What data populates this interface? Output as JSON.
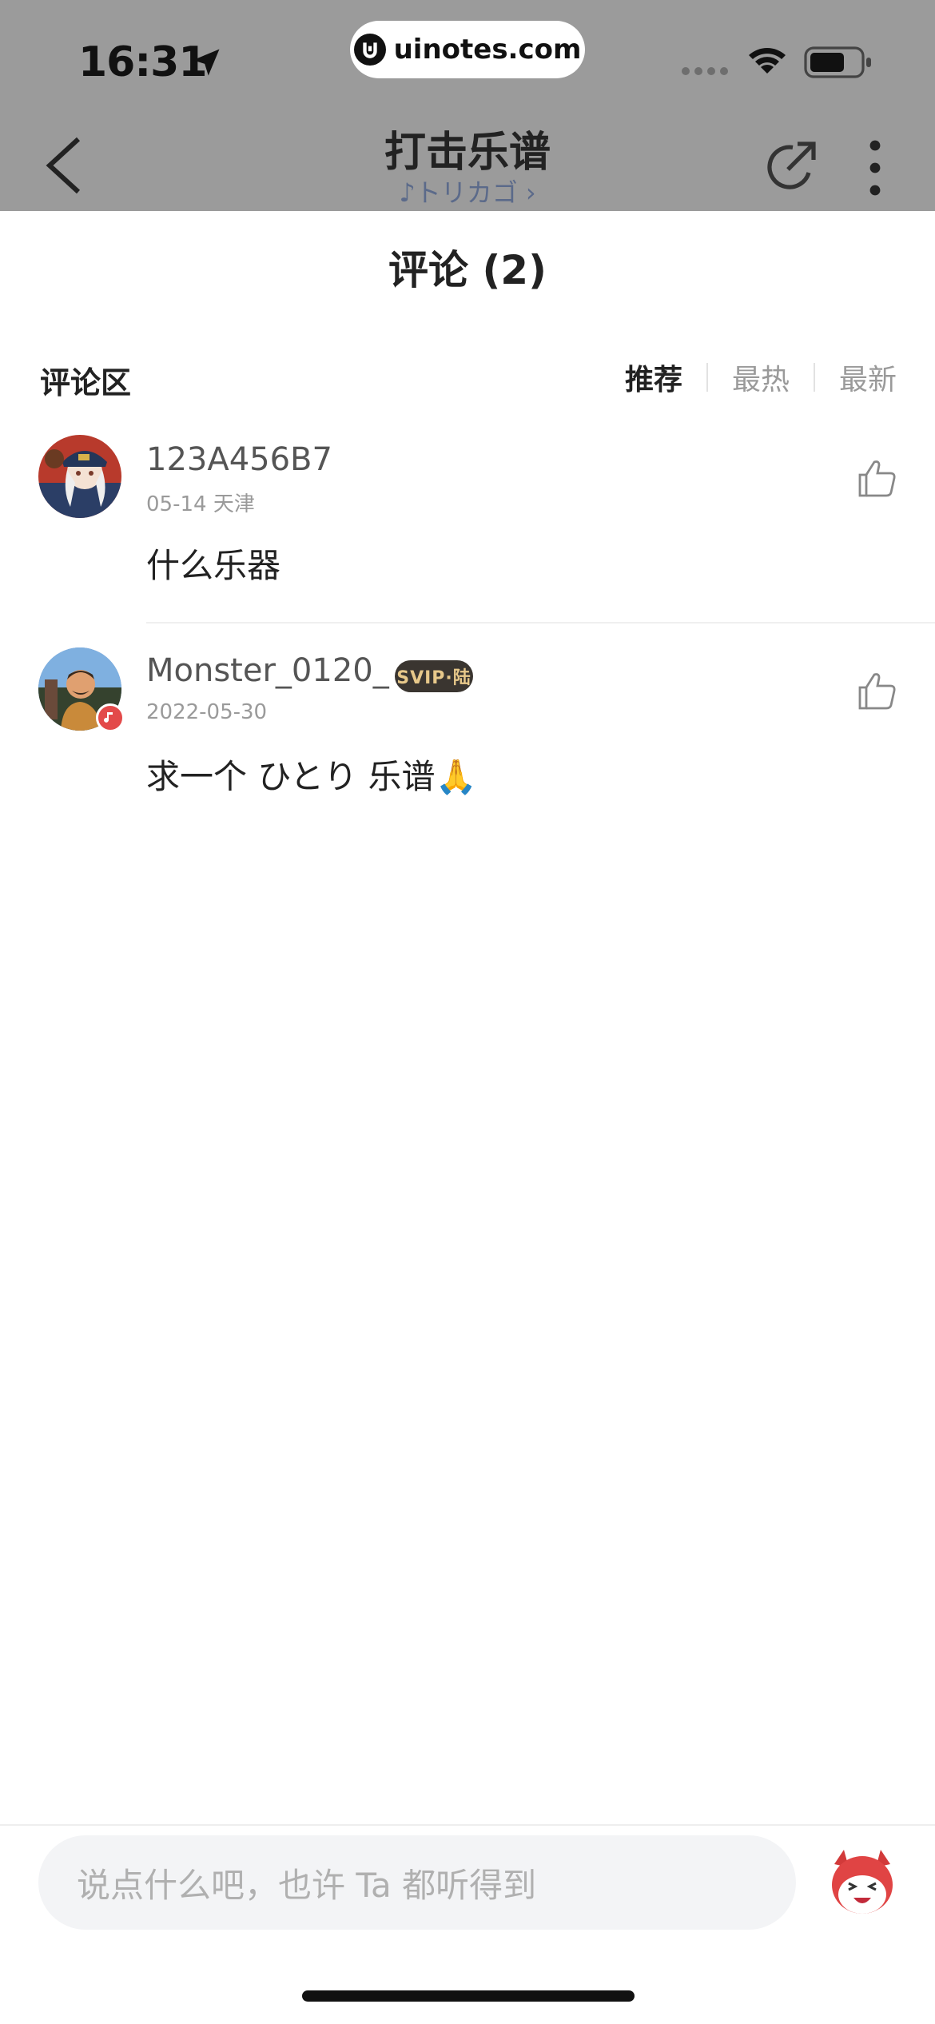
{
  "status_bar": {
    "time": "16:31",
    "url": "uinotes.com"
  },
  "nav": {
    "title": "打击乐谱",
    "subtitle": "♪トリカゴ ›"
  },
  "comments_header": {
    "title": "评论 (2)",
    "section_label": "评论区",
    "sort_tabs": [
      "推荐",
      "最热",
      "最新"
    ],
    "active_tab": "推荐"
  },
  "comments": [
    {
      "user": "123A456B7",
      "meta": "05-14 天津",
      "text": "什么乐器"
    },
    {
      "user": "Monster_0120_",
      "badge": "SVIP·陆",
      "meta": "2022-05-30",
      "text": "求一个  ひとり  乐谱🙏"
    }
  ],
  "input": {
    "placeholder": "说点什么吧，也许 Ta 都听得到"
  },
  "colors": {
    "topbar": "#9b9b9b",
    "subtitle": "#5b6a8a",
    "vip_badge_bg": "#3a3530",
    "vip_badge_text": "#e7c88a",
    "accent_red": "#e34a4a"
  }
}
